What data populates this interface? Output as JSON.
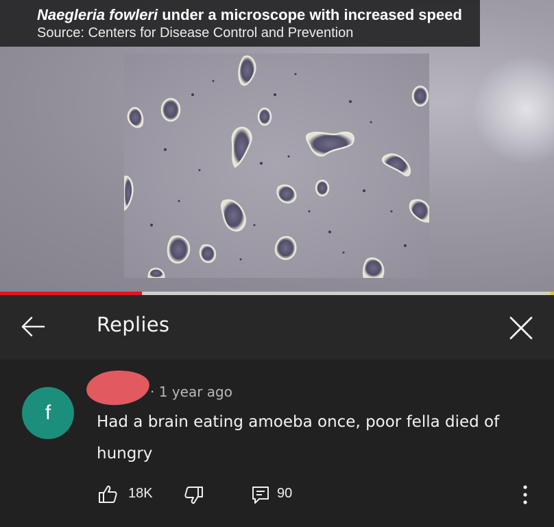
{
  "video": {
    "caption_title_italic": "Naegleria fowleri",
    "caption_title_rest": " under a microscope with increased speed",
    "caption_source": "Source: Centers for Disease Control and Prevention",
    "progress_fraction": 0.256
  },
  "header": {
    "title": "Replies",
    "back_icon": "arrow-left-icon",
    "close_icon": "close-icon"
  },
  "comment": {
    "avatar_letter": "f",
    "avatar_color": "#1b8f7c",
    "author_redaction_color": "#e15a5f",
    "meta": "· 1 year ago",
    "text": "Had a brain eating amoeba once, poor fella died of hungry",
    "likes": "18K",
    "replies": "90"
  },
  "colors": {
    "background": "#212121",
    "header": "#282828",
    "progress": "#e3161b"
  }
}
